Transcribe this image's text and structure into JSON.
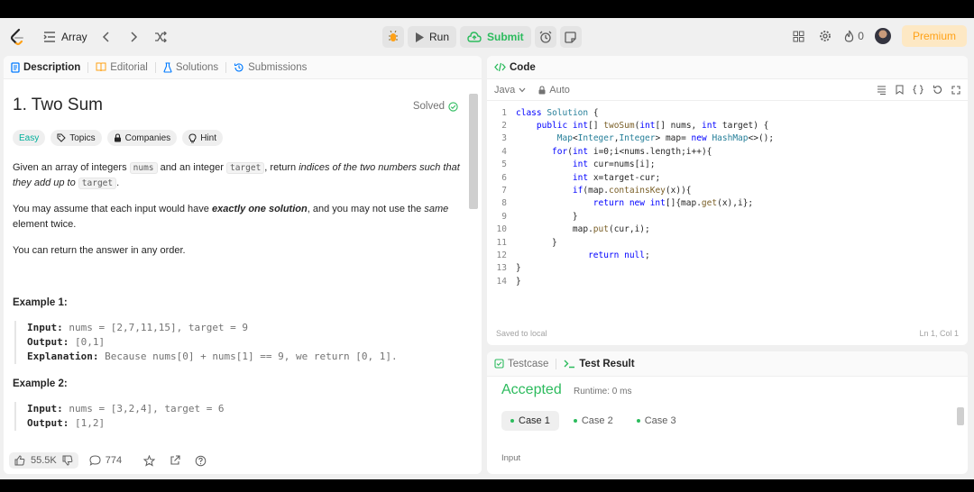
{
  "header": {
    "problem_list_label": "Array",
    "run_label": "Run",
    "submit_label": "Submit",
    "streak_count": "0",
    "premium_label": "Premium"
  },
  "left_tabs": [
    "Description",
    "Editorial",
    "Solutions",
    "Submissions"
  ],
  "problem": {
    "title": "1. Two Sum",
    "status": "Solved",
    "difficulty": "Easy",
    "tags": [
      "Topics",
      "Companies",
      "Hint"
    ],
    "desc_1_a": "Given an array of integers ",
    "desc_1_code1": "nums",
    "desc_1_b": " and an integer ",
    "desc_1_code2": "target",
    "desc_1_c": ", return ",
    "desc_1_em": "indices of the two numbers such that they add up to",
    "desc_1_code3": "target",
    "desc_1_d": ".",
    "desc_2_a": "You may assume that each input would have ",
    "desc_2_strong": "exactly one solution",
    "desc_2_b": ", and you may not use the ",
    "desc_2_em": "same",
    "desc_2_c": " element twice.",
    "desc_3": "You can return the answer in any order.",
    "examples": [
      {
        "heading": "Example 1:",
        "input_label": "Input:",
        "input": " nums = [2,7,11,15], target = 9",
        "output_label": "Output:",
        "output": " [0,1]",
        "explanation_label": "Explanation:",
        "explanation": " Because nums[0] + nums[1] == 9, we return [0, 1]."
      },
      {
        "heading": "Example 2:",
        "input_label": "Input:",
        "input": " nums = [3,2,4], target = 6",
        "output_label": "Output:",
        "output": " [1,2]"
      }
    ]
  },
  "footer": {
    "likes": "55.5K",
    "comments": "774"
  },
  "code_panel": {
    "tab_label": "Code",
    "language": "Java",
    "mode": "Auto",
    "saved_status": "Saved to local",
    "cursor": "Ln 1, Col 1",
    "line_numbers": [
      "1",
      "2",
      "3",
      "4",
      "5",
      "6",
      "7",
      "8",
      "9",
      "10",
      "11",
      "12",
      "13",
      "14"
    ]
  },
  "test_panel": {
    "testcase_tab": "Testcase",
    "result_tab": "Test Result",
    "verdict": "Accepted",
    "runtime": "Runtime: 0 ms",
    "cases": [
      "Case 1",
      "Case 2",
      "Case 3"
    ],
    "input_label": "Input"
  },
  "colors": {
    "accent_green": "#2cbb5d",
    "easy": "#00af9b",
    "premium": "#ffa116",
    "brand_orange": "#ffa116"
  }
}
